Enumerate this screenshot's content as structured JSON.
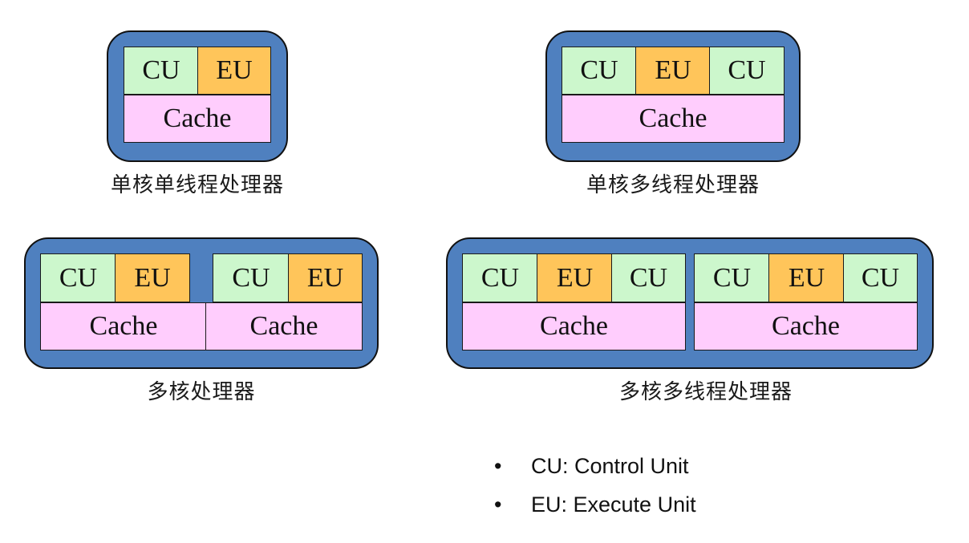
{
  "colors": {
    "chip_blue": "#4f80bf",
    "cu_green": "#ccf7cc",
    "eu_orange": "#ffc55a",
    "cache_pink": "#ffcdfd"
  },
  "labels": {
    "cu": "CU",
    "eu": "EU",
    "cache": "Cache"
  },
  "diagrams": [
    {
      "caption": "单核单线程处理器"
    },
    {
      "caption": "单核多线程处理器"
    },
    {
      "caption": "多核处理器"
    },
    {
      "caption": "多核多线程处理器"
    }
  ],
  "legend": [
    {
      "bullet": "•",
      "text": "CU: Control Unit"
    },
    {
      "bullet": "•",
      "text": "EU: Execute Unit"
    }
  ]
}
